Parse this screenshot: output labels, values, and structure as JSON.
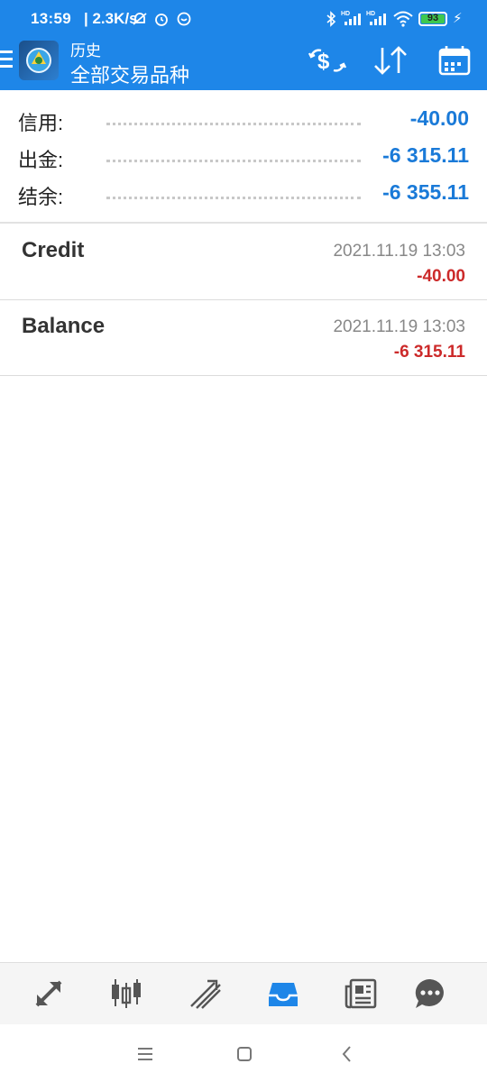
{
  "status_bar": {
    "time": "13:59",
    "speed": "| 2.3K/s",
    "battery": "93",
    "icons": [
      "mute-icon",
      "alarm-icon",
      "notification-icon",
      "bluetooth-icon",
      "signal-hd-icon",
      "signal-hd-icon",
      "wifi-icon",
      "battery-icon",
      "charging-icon"
    ]
  },
  "appbar": {
    "title": "历史",
    "subtitle": "全部交易品种",
    "actions": [
      "currency-exchange-icon",
      "sort-icon",
      "calendar-icon"
    ]
  },
  "summary": [
    {
      "label": "信用:",
      "value": "-40.00"
    },
    {
      "label": "出金:",
      "value": "-6 315.11"
    },
    {
      "label": "结余:",
      "value": "-6 355.11"
    }
  ],
  "deals": [
    {
      "name": "Credit",
      "time": "2021.11.19 13:03",
      "amount": "-40.00"
    },
    {
      "name": "Balance",
      "time": "2021.11.19 13:03",
      "amount": "-6 315.11"
    }
  ],
  "bottom_nav": [
    "quotes-icon",
    "chart-icon",
    "trade-icon",
    "history-icon",
    "news-icon",
    "chat-icon"
  ],
  "colors": {
    "primary": "#1e86e8",
    "value_blue": "#1a7ad8",
    "negative_red": "#cc2a2a",
    "active_nav": "#1e86e8",
    "inactive_nav": "#555555"
  }
}
